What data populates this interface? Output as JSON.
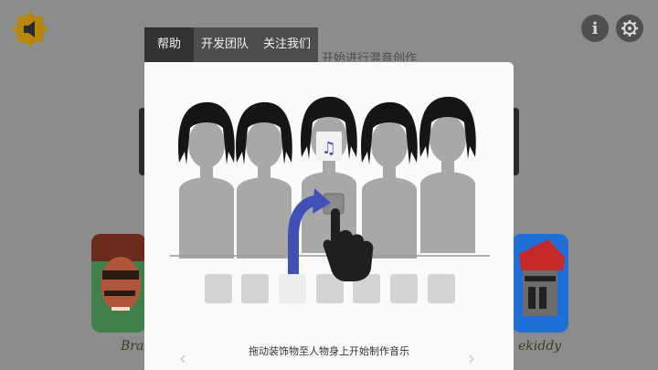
{
  "app": {
    "background_text": "开始进行混音创作",
    "logo_icon": "speaker-gear-icon",
    "info_icon": "info-icon",
    "settings_icon": "gear-icon"
  },
  "dialog": {
    "tabs": [
      {
        "label": "帮助",
        "active": true
      },
      {
        "label": "开发团队",
        "active": false
      },
      {
        "label": "关注我们",
        "active": false
      }
    ],
    "caption": "拖动装饰物至人物身上开始制作音乐",
    "prev_icon": "chevron-left-icon",
    "next_icon": "chevron-right-icon",
    "slot_count": 7
  },
  "background_cards": {
    "left_label": "Braz",
    "right_label": "ekiddy"
  },
  "colors": {
    "overlay": "#8c8c8c",
    "tab_bar": "#4d4d4d",
    "tab_active": "#333333",
    "panel": "#fafafa",
    "arrow": "#3f51b5"
  }
}
